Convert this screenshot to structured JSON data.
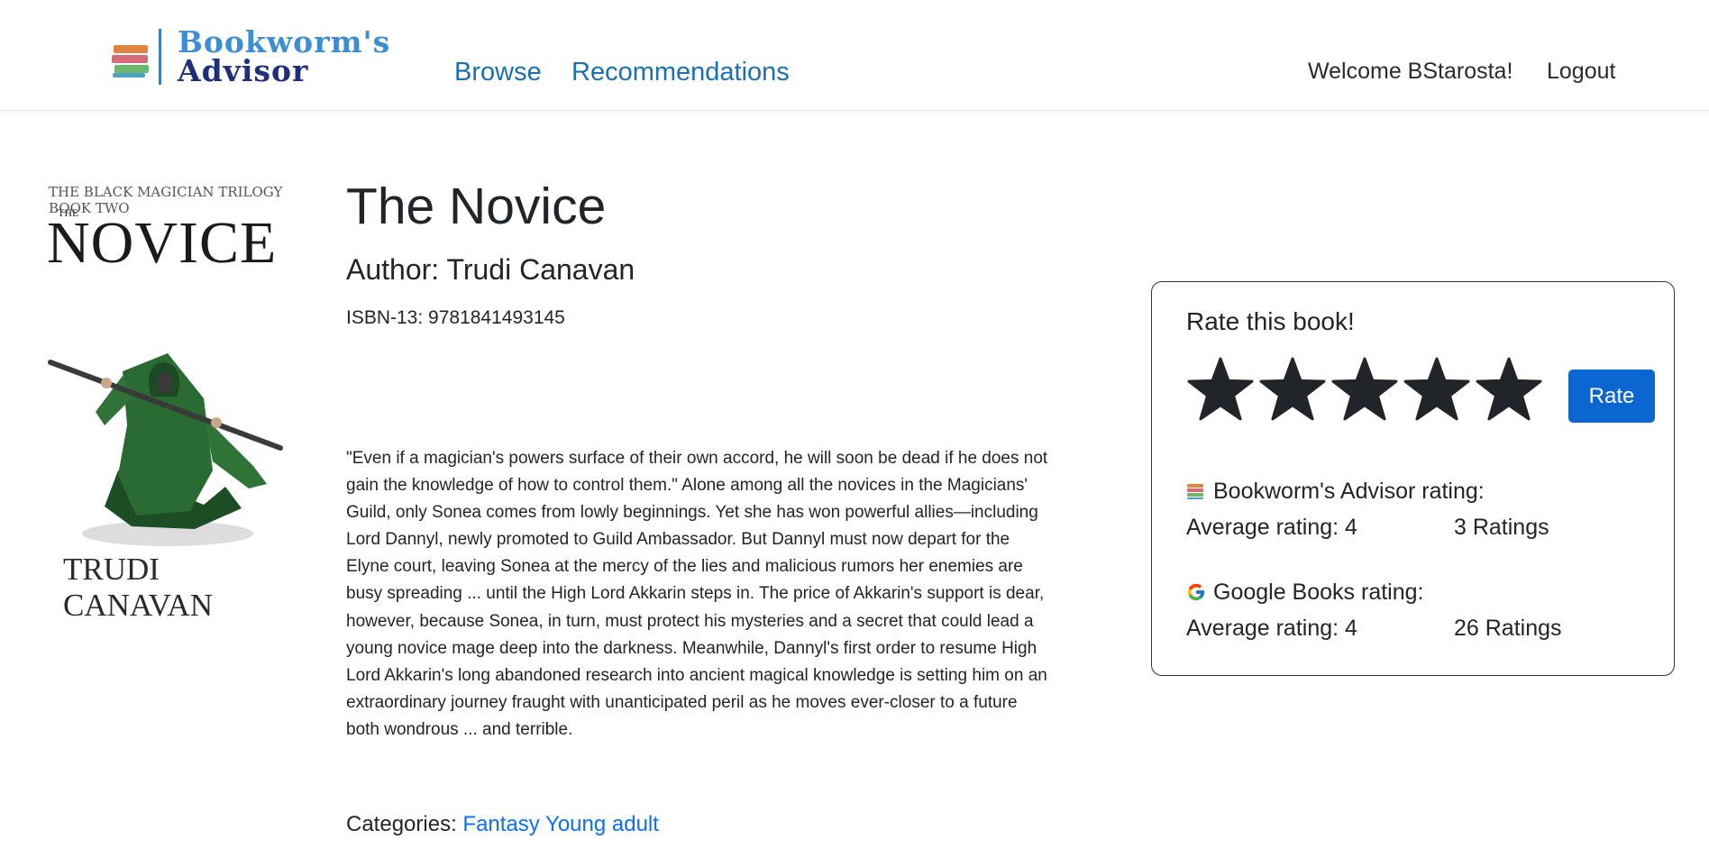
{
  "header": {
    "brand_line1": "Bookworm's",
    "brand_line2": "Advisor",
    "nav": {
      "browse": "Browse",
      "recommendations": "Recommendations"
    },
    "welcome": "Welcome BStarosta!",
    "logout": "Logout"
  },
  "cover": {
    "series": "THE BLACK MAGICIAN TRILOGY BOOK TWO",
    "the": "THE",
    "title": "NOVICE",
    "author": "TRUDI CANAVAN"
  },
  "book": {
    "title": "The Novice",
    "author": "Author: Trudi Canavan",
    "isbn": "ISBN-13: 9781841493145",
    "description": "\"Even if a magician's powers surface of their own accord, he will soon be dead if he does not gain the knowledge of how to control them.\" Alone among all the novices in the Magicians' Guild, only Sonea comes from lowly beginnings. Yet she has won powerful allies—including Lord Dannyl, newly promoted to Guild Ambassador. But Dannyl must now depart for the Elyne court, leaving Sonea at the mercy of the lies and malicious rumors her enemies are busy spreading ... until the High Lord Akkarin steps in. The price of Akkarin's support is dear, however, because Sonea, in turn, must protect his mysteries and a secret that could lead a young novice mage deep into the darkness. Meanwhile, Dannyl's first order to resume High Lord Akkarin's long abandoned research into ancient magical knowledge is setting him on an extraordinary journey fraught with unanticipated peril as he moves ever-closer to a future both wondrous ... and terrible.",
    "categories_label": "Categories:",
    "categories": "Fantasy Young adult"
  },
  "rating_panel": {
    "heading": "Rate this book!",
    "selected_stars": 5,
    "max_stars": 5,
    "rate_button": "Rate",
    "advisor": {
      "label": "Bookworm's Advisor rating:",
      "average": "Average rating: 4",
      "count": "3 Ratings"
    },
    "google": {
      "label": "Google Books rating:",
      "average": "Average rating: 4",
      "count": "26 Ratings"
    }
  },
  "colors": {
    "link": "#1a6fb5",
    "category_link": "#0d6efd",
    "button": "#0b66d1",
    "star": "#212529"
  }
}
